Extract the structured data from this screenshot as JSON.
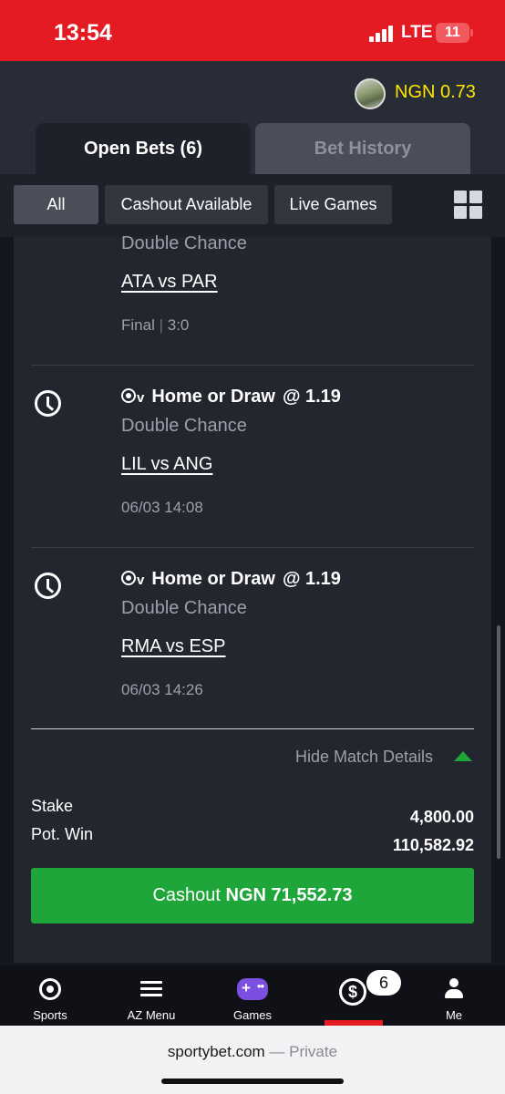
{
  "status": {
    "time": "13:54",
    "network": "LTE",
    "battery": "11"
  },
  "account": {
    "balance": "NGN 0.73"
  },
  "tabs": {
    "open": "Open Bets (6)",
    "history": "Bet History"
  },
  "filters": {
    "all": "All",
    "cashout": "Cashout Available",
    "live": "Live Games"
  },
  "legs": [
    {
      "market": "Double Chance",
      "match": "ATA vs PAR",
      "time": "Final",
      "score": "3:0"
    },
    {
      "selection": "Home or Draw",
      "odds": "@ 1.19",
      "market": "Double Chance",
      "match": "LIL vs ANG",
      "time": "06/03 14:08"
    },
    {
      "selection": "Home or Draw",
      "odds": "@ 1.19",
      "market": "Double Chance",
      "match": "RMA vs ESP",
      "time": "06/03 14:26"
    }
  ],
  "details": {
    "hide_label": "Hide Match Details"
  },
  "summary": {
    "stake_label": "Stake",
    "stake_value": "4,800.00",
    "potwin_label": "Pot. Win",
    "potwin_value": "110,582.92"
  },
  "cashout": {
    "prefix": "Cashout",
    "amount": "NGN 71,552.73"
  },
  "nav": {
    "sports": "Sports",
    "az": "AZ Menu",
    "games": "Games",
    "me": "Me",
    "badge": "6"
  },
  "browser": {
    "domain": "sportybet.com",
    "mode": "— Private"
  },
  "colors": {
    "brand_red": "#e41b23",
    "cashout_green": "#1fa63a",
    "balance_yellow": "#ffe600"
  }
}
